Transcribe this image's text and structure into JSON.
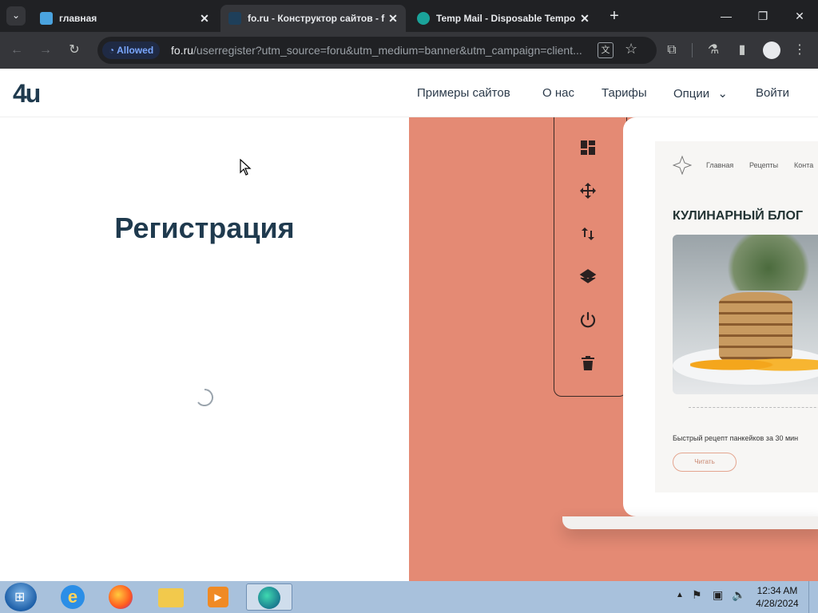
{
  "browser": {
    "tabs": [
      {
        "title": "главная",
        "active": false
      },
      {
        "title": "fo.ru - Конструктор сайтов - f",
        "active": true
      },
      {
        "title": "Temp Mail - Disposable Tempo",
        "active": false
      }
    ],
    "new_tab_symbol": "+",
    "address": {
      "badge": "Allowed",
      "url_host": "fo.ru",
      "url_rest": "/userregister?utm_source=foru&utm_medium=banner&utm_campaign=client..."
    }
  },
  "site": {
    "logo": "4u",
    "nav": [
      "Примеры сайтов",
      "О нас",
      "Тарифы",
      "Опции",
      "Войти"
    ],
    "page_title": "Регистрация"
  },
  "preview": {
    "nav": [
      "Главная",
      "Рецепты",
      "Конта"
    ],
    "heading": "КУЛИНАРНЫЙ БЛОГ",
    "caption": "Быстрый рецепт панкейков за 30 мин",
    "button": "Читать"
  },
  "taskbar": {
    "time": "12:34 AM",
    "date": "4/28/2024"
  },
  "colors": {
    "tabstrip": "#202124",
    "toolbar": "#35363a",
    "salmon": "#e48a74",
    "title": "#1f3a4e"
  }
}
